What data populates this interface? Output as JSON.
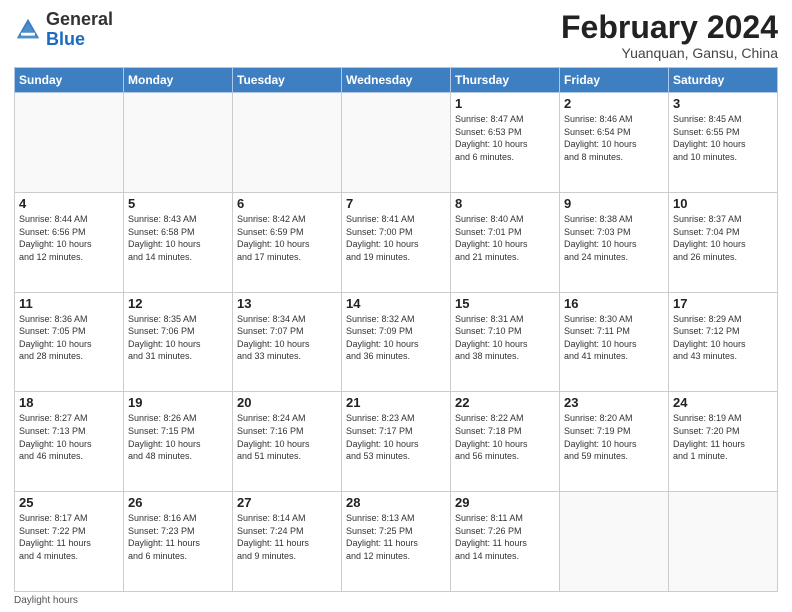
{
  "header": {
    "logo_general": "General",
    "logo_blue": "Blue",
    "month_title": "February 2024",
    "subtitle": "Yuanquan, Gansu, China"
  },
  "days_of_week": [
    "Sunday",
    "Monday",
    "Tuesday",
    "Wednesday",
    "Thursday",
    "Friday",
    "Saturday"
  ],
  "weeks": [
    [
      {
        "day": "",
        "info": ""
      },
      {
        "day": "",
        "info": ""
      },
      {
        "day": "",
        "info": ""
      },
      {
        "day": "",
        "info": ""
      },
      {
        "day": "1",
        "info": "Sunrise: 8:47 AM\nSunset: 6:53 PM\nDaylight: 10 hours\nand 6 minutes."
      },
      {
        "day": "2",
        "info": "Sunrise: 8:46 AM\nSunset: 6:54 PM\nDaylight: 10 hours\nand 8 minutes."
      },
      {
        "day": "3",
        "info": "Sunrise: 8:45 AM\nSunset: 6:55 PM\nDaylight: 10 hours\nand 10 minutes."
      }
    ],
    [
      {
        "day": "4",
        "info": "Sunrise: 8:44 AM\nSunset: 6:56 PM\nDaylight: 10 hours\nand 12 minutes."
      },
      {
        "day": "5",
        "info": "Sunrise: 8:43 AM\nSunset: 6:58 PM\nDaylight: 10 hours\nand 14 minutes."
      },
      {
        "day": "6",
        "info": "Sunrise: 8:42 AM\nSunset: 6:59 PM\nDaylight: 10 hours\nand 17 minutes."
      },
      {
        "day": "7",
        "info": "Sunrise: 8:41 AM\nSunset: 7:00 PM\nDaylight: 10 hours\nand 19 minutes."
      },
      {
        "day": "8",
        "info": "Sunrise: 8:40 AM\nSunset: 7:01 PM\nDaylight: 10 hours\nand 21 minutes."
      },
      {
        "day": "9",
        "info": "Sunrise: 8:38 AM\nSunset: 7:03 PM\nDaylight: 10 hours\nand 24 minutes."
      },
      {
        "day": "10",
        "info": "Sunrise: 8:37 AM\nSunset: 7:04 PM\nDaylight: 10 hours\nand 26 minutes."
      }
    ],
    [
      {
        "day": "11",
        "info": "Sunrise: 8:36 AM\nSunset: 7:05 PM\nDaylight: 10 hours\nand 28 minutes."
      },
      {
        "day": "12",
        "info": "Sunrise: 8:35 AM\nSunset: 7:06 PM\nDaylight: 10 hours\nand 31 minutes."
      },
      {
        "day": "13",
        "info": "Sunrise: 8:34 AM\nSunset: 7:07 PM\nDaylight: 10 hours\nand 33 minutes."
      },
      {
        "day": "14",
        "info": "Sunrise: 8:32 AM\nSunset: 7:09 PM\nDaylight: 10 hours\nand 36 minutes."
      },
      {
        "day": "15",
        "info": "Sunrise: 8:31 AM\nSunset: 7:10 PM\nDaylight: 10 hours\nand 38 minutes."
      },
      {
        "day": "16",
        "info": "Sunrise: 8:30 AM\nSunset: 7:11 PM\nDaylight: 10 hours\nand 41 minutes."
      },
      {
        "day": "17",
        "info": "Sunrise: 8:29 AM\nSunset: 7:12 PM\nDaylight: 10 hours\nand 43 minutes."
      }
    ],
    [
      {
        "day": "18",
        "info": "Sunrise: 8:27 AM\nSunset: 7:13 PM\nDaylight: 10 hours\nand 46 minutes."
      },
      {
        "day": "19",
        "info": "Sunrise: 8:26 AM\nSunset: 7:15 PM\nDaylight: 10 hours\nand 48 minutes."
      },
      {
        "day": "20",
        "info": "Sunrise: 8:24 AM\nSunset: 7:16 PM\nDaylight: 10 hours\nand 51 minutes."
      },
      {
        "day": "21",
        "info": "Sunrise: 8:23 AM\nSunset: 7:17 PM\nDaylight: 10 hours\nand 53 minutes."
      },
      {
        "day": "22",
        "info": "Sunrise: 8:22 AM\nSunset: 7:18 PM\nDaylight: 10 hours\nand 56 minutes."
      },
      {
        "day": "23",
        "info": "Sunrise: 8:20 AM\nSunset: 7:19 PM\nDaylight: 10 hours\nand 59 minutes."
      },
      {
        "day": "24",
        "info": "Sunrise: 8:19 AM\nSunset: 7:20 PM\nDaylight: 11 hours\nand 1 minute."
      }
    ],
    [
      {
        "day": "25",
        "info": "Sunrise: 8:17 AM\nSunset: 7:22 PM\nDaylight: 11 hours\nand 4 minutes."
      },
      {
        "day": "26",
        "info": "Sunrise: 8:16 AM\nSunset: 7:23 PM\nDaylight: 11 hours\nand 6 minutes."
      },
      {
        "day": "27",
        "info": "Sunrise: 8:14 AM\nSunset: 7:24 PM\nDaylight: 11 hours\nand 9 minutes."
      },
      {
        "day": "28",
        "info": "Sunrise: 8:13 AM\nSunset: 7:25 PM\nDaylight: 11 hours\nand 12 minutes."
      },
      {
        "day": "29",
        "info": "Sunrise: 8:11 AM\nSunset: 7:26 PM\nDaylight: 11 hours\nand 14 minutes."
      },
      {
        "day": "",
        "info": ""
      },
      {
        "day": "",
        "info": ""
      }
    ]
  ],
  "footer": {
    "note": "Daylight hours"
  }
}
